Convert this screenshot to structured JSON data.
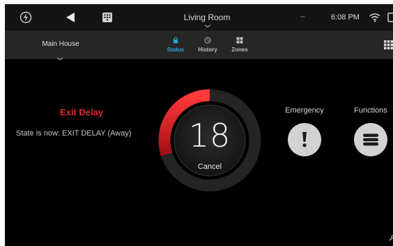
{
  "topbar": {
    "room_title": "Living Room",
    "dash_text": "--",
    "time": "6:08 PM",
    "icons": [
      "logo-icon",
      "back-icon",
      "keypad-icon",
      "room-chevron-icon",
      "wifi-icon",
      "battery-icon"
    ]
  },
  "navbar": {
    "partition": "Main House",
    "tabs": [
      {
        "label": "Status",
        "icon": "lock-icon",
        "active": true
      },
      {
        "label": "History",
        "icon": "history-icon",
        "active": false
      },
      {
        "label": "Zones",
        "icon": "zones-icon",
        "active": false
      }
    ],
    "grid_icon": "grid-icon"
  },
  "status": {
    "mode_label": "Exit Delay",
    "state_text": "State is now: EXIT DELAY (Away)",
    "countdown": "18",
    "countdown_progress": 0.3,
    "cancel_label": "Cancel"
  },
  "actions": {
    "emergency_label": "Emergency",
    "functions_label": "Functions"
  },
  "colors": {
    "accent_blue": "#27a7e0",
    "alarm_red": "#e2262d",
    "background": "#000000"
  }
}
